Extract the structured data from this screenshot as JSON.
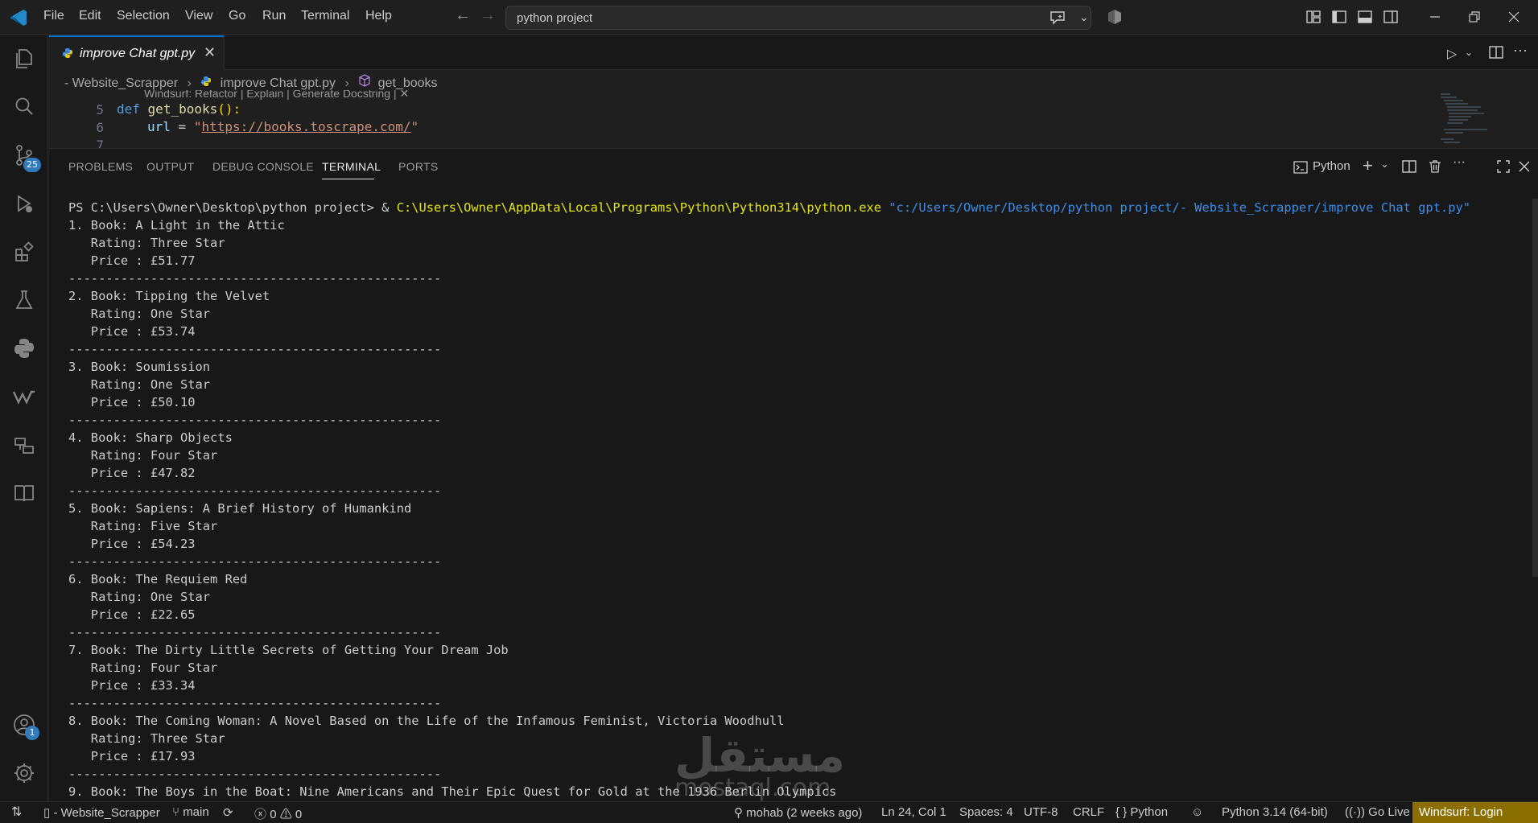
{
  "menu": [
    "File",
    "Edit",
    "Selection",
    "View",
    "Go",
    "Run",
    "Terminal",
    "Help"
  ],
  "command_center": {
    "text": "python project"
  },
  "activity": {
    "source_control_badge": "25",
    "accounts_badge": "1"
  },
  "tab": {
    "label": "improve Chat gpt.py"
  },
  "breadcrumb": {
    "folder": "- Website_Scrapper",
    "file": "improve Chat gpt.py",
    "symbol": "get_books"
  },
  "editor": {
    "codelens": "Windsurf: Refactor | Explain | Generate Docstring | ✕",
    "lines": [
      {
        "num": "5",
        "kw": "def",
        "fn": "get_books",
        "rest": "():"
      },
      {
        "num": "6",
        "var": "url",
        "eq": " = ",
        "str_open": "\"",
        "url": "https://books.toscrape.com/",
        "str_close": "\""
      },
      {
        "num": "7"
      }
    ]
  },
  "panel": {
    "tabs": [
      "PROBLEMS",
      "OUTPUT",
      "DEBUG CONSOLE",
      "TERMINAL",
      "PORTS"
    ],
    "active_tab": "TERMINAL",
    "terminal_profile": "Python"
  },
  "terminal": {
    "prompt": "PS C:\\Users\\Owner\\Desktop\\python project> & ",
    "exe": "C:\\Users\\Owner\\AppData\\Local\\Programs\\Python\\Python314\\python.exe",
    "arg": "\"c:/Users/Owner/Desktop/python project/- Website_Scrapper/improve Chat gpt.py\"",
    "separator": "--------------------------------------------------",
    "books": [
      {
        "title": "1. Book: A Light in the Attic",
        "rating": "   Rating: Three Star",
        "price": "   Price : £51.77"
      },
      {
        "title": "2. Book: Tipping the Velvet",
        "rating": "   Rating: One Star",
        "price": "   Price : £53.74"
      },
      {
        "title": "3. Book: Soumission",
        "rating": "   Rating: One Star",
        "price": "   Price : £50.10"
      },
      {
        "title": "4. Book: Sharp Objects",
        "rating": "   Rating: Four Star",
        "price": "   Price : £47.82"
      },
      {
        "title": "5. Book: Sapiens: A Brief History of Humankind",
        "rating": "   Rating: Five Star",
        "price": "   Price : £54.23"
      },
      {
        "title": "6. Book: The Requiem Red",
        "rating": "   Rating: One Star",
        "price": "   Price : £22.65"
      },
      {
        "title": "7. Book: The Dirty Little Secrets of Getting Your Dream Job",
        "rating": "   Rating: Four Star",
        "price": "   Price : £33.34"
      },
      {
        "title": "8. Book: The Coming Woman: A Novel Based on the Life of the Infamous Feminist, Victoria Woodhull",
        "rating": "   Rating: Three Star",
        "price": "   Price : £17.93"
      },
      {
        "title": "9. Book: The Boys in the Boat: Nine Americans and Their Epic Quest for Gold at the 1936 Berlin Olympics",
        "rating": "",
        "price": ""
      }
    ]
  },
  "watermark": {
    "main": "مستقل",
    "sub": "mostaql.com"
  },
  "status": {
    "folder": "- Website_Scrapper",
    "branch": "main",
    "errors": "0",
    "warnings": "0",
    "blame": "mohab (2 weeks ago)",
    "position": "Ln 24, Col 1",
    "spaces": "Spaces: 4",
    "encoding": "UTF-8",
    "eol": "CRLF",
    "language": "Python",
    "interpreter": "Python 3.14 (64-bit)",
    "golive": "Go Live",
    "windsurf": "Windsurf: Login"
  },
  "colors": {
    "accent": "#0078d4",
    "badge": "#2f7bbe",
    "windsurf_bg": "#8a6f00"
  }
}
